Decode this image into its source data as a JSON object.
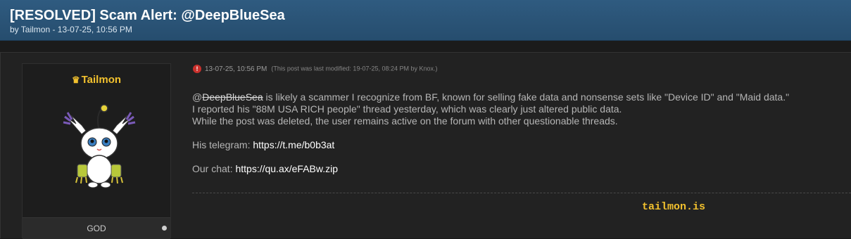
{
  "thread": {
    "title": "[RESOLVED] Scam Alert: @DeepBlueSea",
    "byline": "by Tailmon - 13-07-25, 10:56 PM"
  },
  "author": {
    "name": "Tailmon",
    "crown_icon": "crown-icon",
    "rank": "GOD",
    "name_color": "#f2c12e"
  },
  "post": {
    "date": "13-07-25, 10:56 PM",
    "modified": "(This post was last modified: 19-07-25, 08:24 PM by Knox.)",
    "alert_icon": "!",
    "mention_at": "@",
    "mention_name": "DeepBlueSea",
    "line1_rest": " is likely a scammer I recognize from BF, known for selling fake data and nonsense sets like \"Device ID\" and \"Maid data.\"",
    "line2": "I reported his \"88M USA RICH people\" thread yesterday, which was clearly just altered public data.",
    "line3": "While the post was deleted, the user remains active on the forum with other questionable threads.",
    "telegram_label": "His telegram: ",
    "telegram_link": "https://t.me/b0b3at",
    "chat_label": "Our chat: ",
    "chat_link": "https://qu.ax/eFABw.zip"
  },
  "signature": {
    "text": "tailmon.is"
  }
}
